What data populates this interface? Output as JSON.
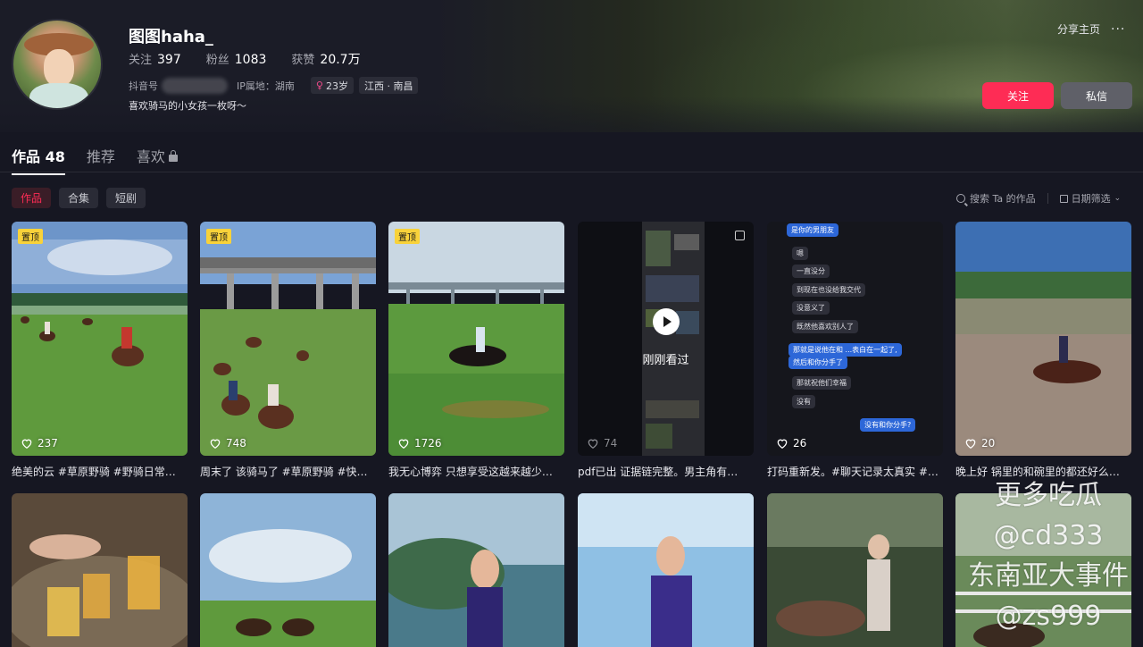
{
  "profile": {
    "nickname": "图图haha_",
    "following_label": "关注",
    "following": "397",
    "followers_label": "粉丝",
    "followers": "1083",
    "likes_label": "获赞",
    "likes": "20.7万",
    "douyin_id_label": "抖音号",
    "ip_label": "IP属地：湖南",
    "age_tag": "23岁",
    "location_tag": "江西 · 南昌",
    "bio": "喜欢骑马的小女孩一枚呀～"
  },
  "actions": {
    "share": "分享主页",
    "more": "···",
    "follow": "关注",
    "message": "私信"
  },
  "tabs": {
    "works": "作品 48",
    "recommend": "推荐",
    "likes": "喜欢"
  },
  "subtabs": [
    "作品",
    "合集",
    "短剧"
  ],
  "tools": {
    "search": "搜索 Ta 的作品",
    "date_filter": "日期筛选"
  },
  "videos": [
    {
      "pinned": "置顶",
      "likes": "237",
      "caption": "绝美的云 #草原野骑 #野骑日常…"
    },
    {
      "pinned": "置顶",
      "likes": "748",
      "caption": "周末了 该骑马了 #草原野骑 #快…"
    },
    {
      "pinned": "置顶",
      "likes": "1726",
      "caption": "我无心博弈 只想享受这越来越少…"
    },
    {
      "likes": "74",
      "caption": "pdf已出 证据链完整。男主角有…",
      "overlay": "刚刚看过"
    },
    {
      "likes": "26",
      "caption": "打码重新发。#聊天记录太真实 #…"
    },
    {
      "likes": "20",
      "caption": "晚上好 锅里的和碗里的都还好么…"
    }
  ],
  "chat_lines": [
    {
      "side": "out",
      "text": "是你的男朋友"
    },
    {
      "side": "in",
      "text": "嗯"
    },
    {
      "side": "in",
      "text": "一直没分"
    },
    {
      "side": "in",
      "text": "到现在也没给我交代"
    },
    {
      "side": "in",
      "text": "没意义了"
    },
    {
      "side": "in",
      "text": "既然他喜欢别人了"
    },
    {
      "side": "out",
      "text": "那就是说他在和 ...表白在一起了,"
    },
    {
      "side": "out",
      "text": "然后和你分手了"
    },
    {
      "side": "in",
      "text": "那就祝他们幸福"
    },
    {
      "side": "in",
      "text": "没有"
    },
    {
      "side": "out",
      "text": "没有和你分手?"
    }
  ],
  "watermark": [
    "更多吃瓜",
    "@cd333",
    "东南亚大事件",
    "@zs999"
  ],
  "colors": {
    "accent": "#fe2c55",
    "pin": "#f8d23a",
    "background": "#161722"
  }
}
